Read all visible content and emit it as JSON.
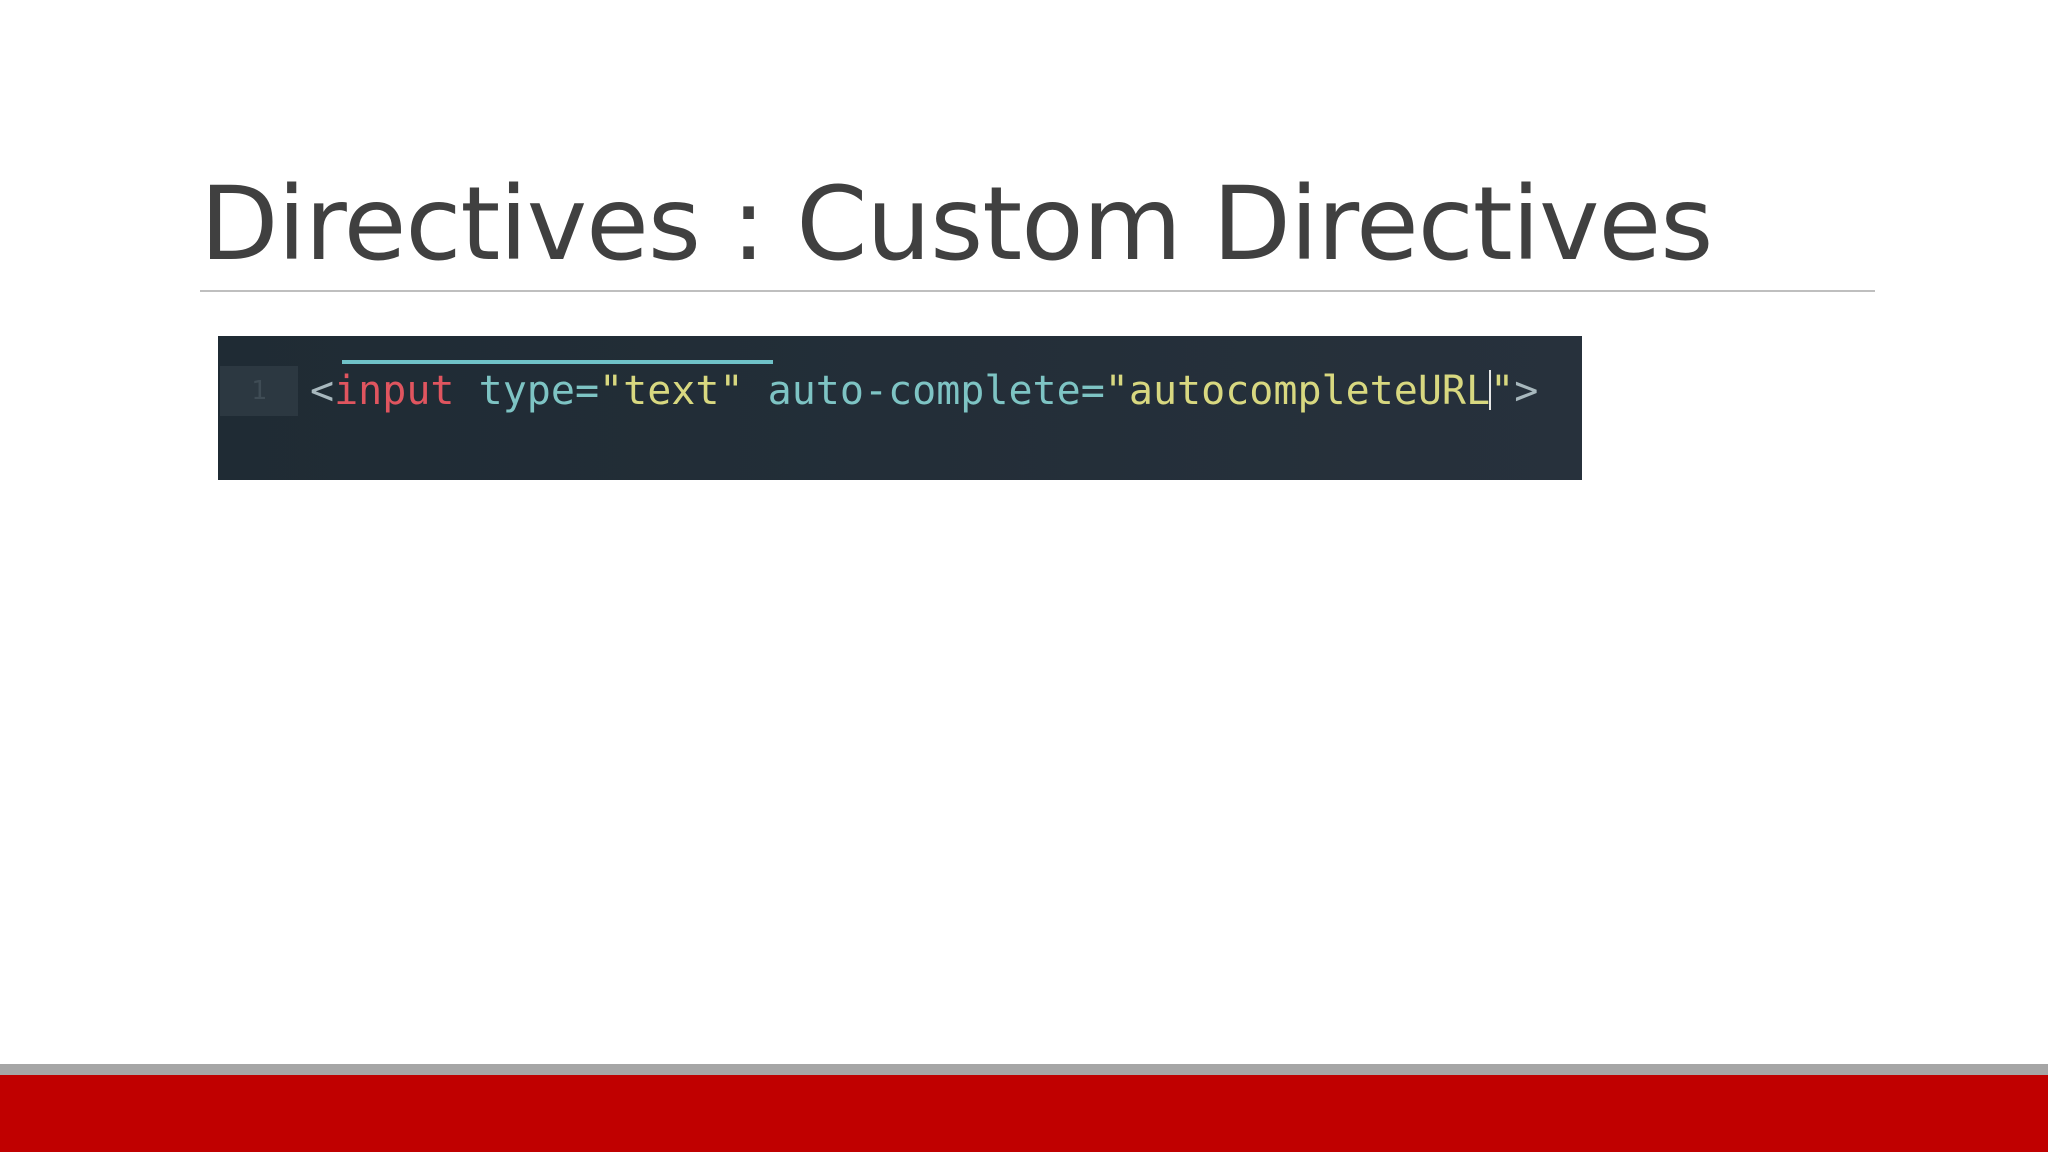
{
  "slide": {
    "title": "Directives : Custom Directives"
  },
  "code": {
    "line_number": "1",
    "tokens": {
      "open_bracket": "<",
      "tag": "input",
      "space1": " ",
      "attr1_name": "type=",
      "attr1_value": "\"text\"",
      "space2": " ",
      "attr2_name": "auto-complete=",
      "attr2_value_before_caret": "\"autocompleteURL",
      "attr2_value_after_caret": "\"",
      "close_bracket": ">"
    }
  },
  "colors": {
    "title": "#404040",
    "code_background": "#27313c",
    "tag": "#e0555f",
    "attribute": "#7ec4c4",
    "string": "#d8d880",
    "punctuation": "#a8b8be",
    "footer_accent": "#c00000",
    "footer_stripe": "#a6a6a6"
  }
}
